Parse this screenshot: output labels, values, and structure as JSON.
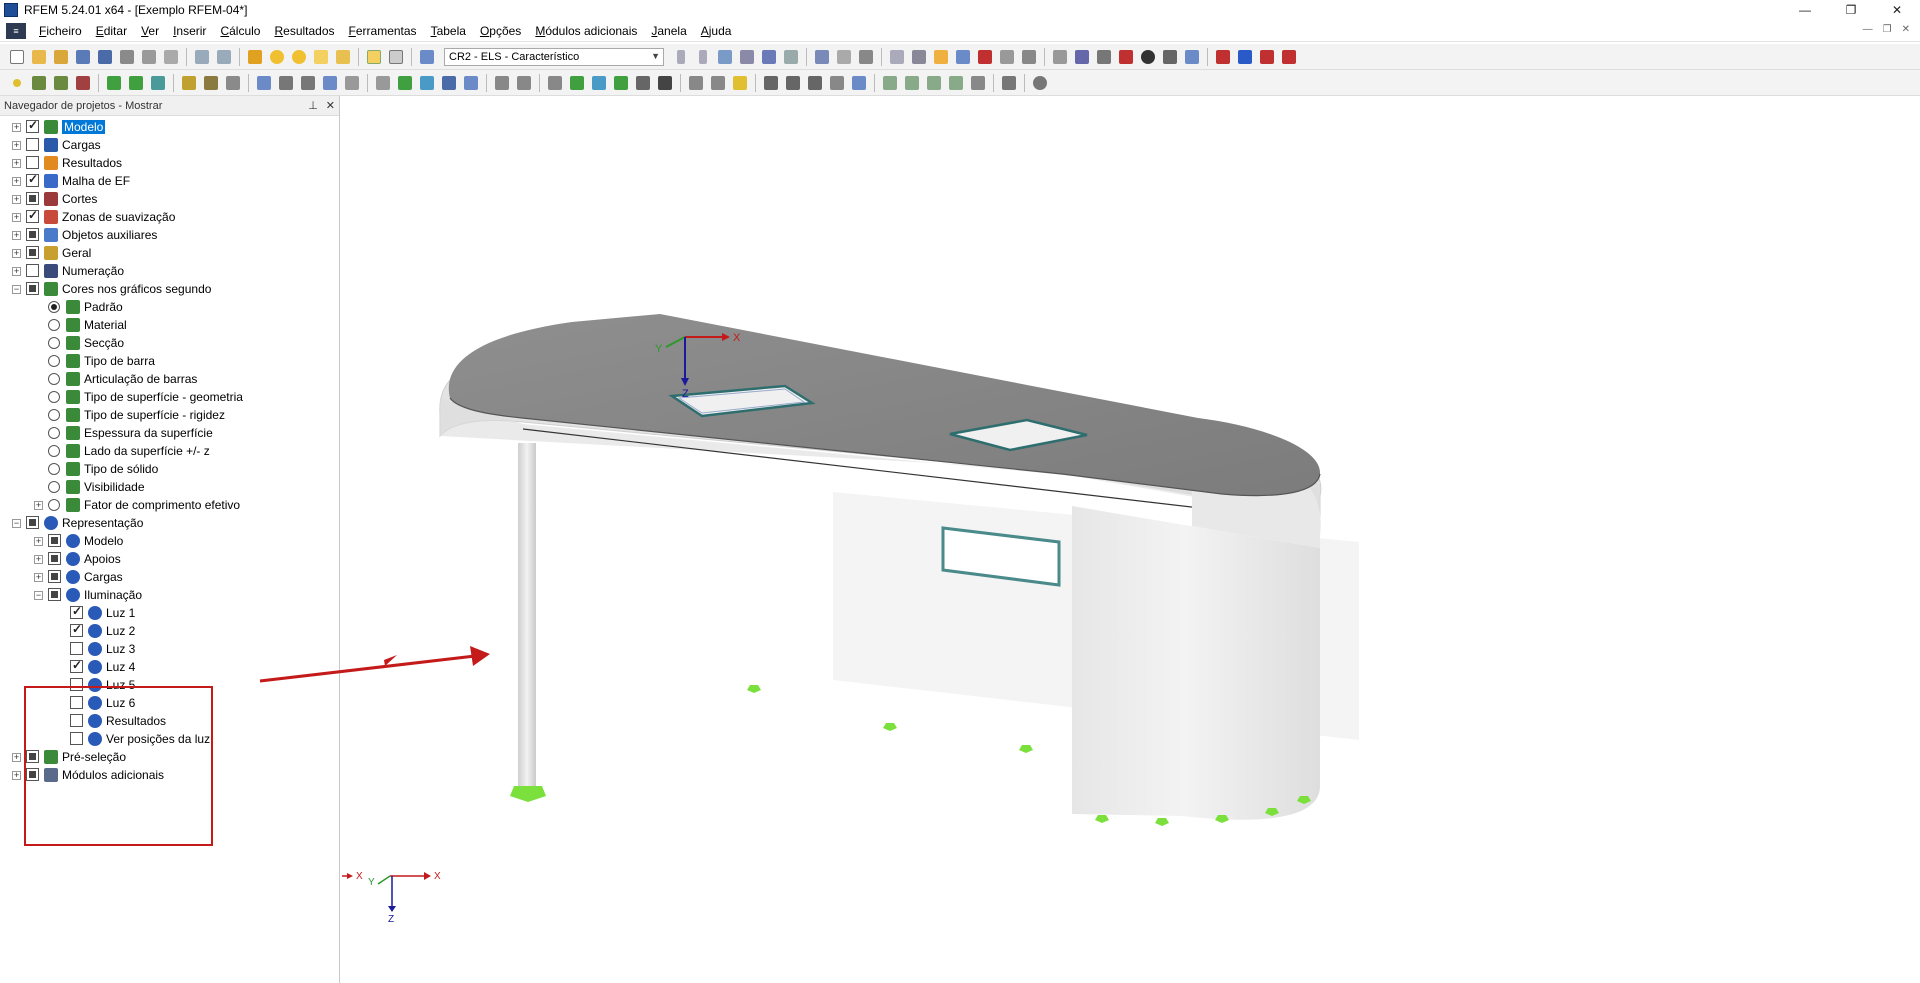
{
  "window": {
    "title": "RFEM 5.24.01 x64 - [Exemplo RFEM-04*]",
    "buttons": [
      "—",
      "❐",
      "✕"
    ]
  },
  "menu": {
    "items": [
      "Ficheiro",
      "Editar",
      "Ver",
      "Inserir",
      "Cálculo",
      "Resultados",
      "Ferramentas",
      "Tabela",
      "Opções",
      "Módulos adicionais",
      "Janela",
      "Ajuda"
    ],
    "mdi_controls": [
      "—",
      "❐",
      "✕"
    ]
  },
  "toolbar": {
    "loadcase_selected": "CR2 - ELS - Característico"
  },
  "navigator": {
    "title": "Navegador de projetos - Mostrar",
    "pin": "⊥",
    "close": "✕",
    "items": [
      {
        "label": "Modelo",
        "level": 0,
        "state": "on",
        "expander": "+",
        "icon": "model-icon",
        "selected": true
      },
      {
        "label": "Cargas",
        "level": 0,
        "state": "off",
        "expander": "+",
        "icon": "loads-icon"
      },
      {
        "label": "Resultados",
        "level": 0,
        "state": "off",
        "expander": "+",
        "icon": "results-icon"
      },
      {
        "label": "Malha de EF",
        "level": 0,
        "state": "on",
        "expander": "+",
        "icon": "fe-mesh-icon"
      },
      {
        "label": "Cortes",
        "level": 0,
        "state": "partial",
        "expander": "+",
        "icon": "sections-icon"
      },
      {
        "label": "Zonas de suavização",
        "level": 0,
        "state": "on",
        "expander": "+",
        "icon": "smoothing-icon"
      },
      {
        "label": "Objetos auxiliares",
        "level": 0,
        "state": "partial",
        "expander": "+",
        "icon": "guide-objects-icon"
      },
      {
        "label": "Geral",
        "level": 0,
        "state": "partial",
        "expander": "+",
        "icon": "general-icon"
      },
      {
        "label": "Numeração",
        "level": 0,
        "state": "off",
        "expander": "+",
        "icon": "numbering-icon"
      },
      {
        "label": "Cores nos gráficos segundo",
        "level": 0,
        "state": "partial",
        "expander": "-",
        "icon": "colors-icon"
      },
      {
        "label": "Padrão",
        "level": 1,
        "state": "radio-on",
        "icon": "colors-icon"
      },
      {
        "label": "Material",
        "level": 1,
        "state": "radio-off",
        "icon": "colors-icon"
      },
      {
        "label": "Secção",
        "level": 1,
        "state": "radio-off",
        "icon": "colors-icon"
      },
      {
        "label": "Tipo de barra",
        "level": 1,
        "state": "radio-off",
        "icon": "colors-icon"
      },
      {
        "label": "Articulação de barras",
        "level": 1,
        "state": "radio-off",
        "icon": "colors-icon"
      },
      {
        "label": "Tipo de superfície - geometria",
        "level": 1,
        "state": "radio-off",
        "icon": "colors-icon"
      },
      {
        "label": "Tipo de superfície - rigidez",
        "level": 1,
        "state": "radio-off",
        "icon": "colors-icon"
      },
      {
        "label": "Espessura da superfície",
        "level": 1,
        "state": "radio-off",
        "icon": "colors-icon"
      },
      {
        "label": "Lado da superfície +/- z",
        "level": 1,
        "state": "radio-off",
        "icon": "colors-icon"
      },
      {
        "label": "Tipo de sólido",
        "level": 1,
        "state": "radio-off",
        "icon": "colors-icon"
      },
      {
        "label": "Visibilidade",
        "level": 1,
        "state": "radio-off",
        "icon": "colors-icon"
      },
      {
        "label": "Fator de comprimento efetivo",
        "level": 1,
        "state": "radio-off",
        "expander": "+",
        "icon": "colors-icon"
      },
      {
        "label": "Representação",
        "level": 0,
        "state": "partial",
        "expander": "-",
        "icon": "teapot-icon"
      },
      {
        "label": "Modelo",
        "level": 1,
        "state": "partial",
        "expander": "+",
        "icon": "teapot-icon"
      },
      {
        "label": "Apoios",
        "level": 1,
        "state": "partial",
        "expander": "+",
        "icon": "teapot-icon"
      },
      {
        "label": "Cargas",
        "level": 1,
        "state": "partial",
        "expander": "+",
        "icon": "teapot-icon"
      },
      {
        "label": "Iluminação",
        "level": 1,
        "state": "partial",
        "expander": "-",
        "icon": "teapot-icon"
      },
      {
        "label": "Luz 1",
        "level": 2,
        "state": "on",
        "icon": "teapot-icon"
      },
      {
        "label": "Luz 2",
        "level": 2,
        "state": "on",
        "icon": "teapot-icon"
      },
      {
        "label": "Luz 3",
        "level": 2,
        "state": "off",
        "icon": "teapot-icon"
      },
      {
        "label": "Luz 4",
        "level": 2,
        "state": "on",
        "icon": "teapot-icon"
      },
      {
        "label": "Luz 5",
        "level": 2,
        "state": "off",
        "icon": "teapot-icon"
      },
      {
        "label": "Luz 6",
        "level": 2,
        "state": "off",
        "icon": "teapot-icon"
      },
      {
        "label": "Resultados",
        "level": 2,
        "state": "off",
        "icon": "teapot-icon"
      },
      {
        "label": "Ver posições da luz",
        "level": 2,
        "state": "off",
        "icon": "teapot-icon"
      },
      {
        "label": "Pré-seleção",
        "level": 0,
        "state": "partial",
        "expander": "+",
        "icon": "preselection-icon"
      },
      {
        "label": "Módulos adicionais",
        "level": 0,
        "state": "partial",
        "expander": "+",
        "icon": "addon-modules-icon"
      }
    ]
  },
  "viewport": {
    "axes_main": {
      "x": "X",
      "y": "Y",
      "z": "Z"
    },
    "axes_corner": {
      "x": "X",
      "y": "Y",
      "z": "Z"
    }
  },
  "colors": {
    "highlight": "#c41a1a",
    "arrow": "#c41a1a",
    "support": "#7be03c",
    "selection": "#0078d7"
  }
}
